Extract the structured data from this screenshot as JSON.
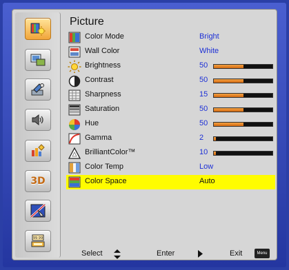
{
  "menu": {
    "title": "Picture",
    "items": [
      {
        "label": "Color Mode",
        "value": "Bright",
        "icon": "color-mode-icon"
      },
      {
        "label": "Wall Color",
        "value": "White",
        "icon": "wall-color-icon"
      },
      {
        "label": "Brightness",
        "value": "50",
        "slider": 0.5,
        "icon": "brightness-icon"
      },
      {
        "label": "Contrast",
        "value": "50",
        "slider": 0.5,
        "icon": "contrast-icon"
      },
      {
        "label": "Sharpness",
        "value": "15",
        "slider": 0.5,
        "icon": "sharpness-icon"
      },
      {
        "label": "Saturation",
        "value": "50",
        "slider": 0.5,
        "icon": "saturation-icon"
      },
      {
        "label": "Hue",
        "value": "50",
        "slider": 0.5,
        "icon": "hue-icon"
      },
      {
        "label": "Gamma",
        "value": "2",
        "slider": 0.03,
        "icon": "gamma-icon"
      },
      {
        "label": "BrilliantColor™",
        "value": "10",
        "slider": 0.03,
        "icon": "brilliantcolor-icon"
      },
      {
        "label": "Color Temp",
        "value": "Low",
        "icon": "color-temp-icon"
      },
      {
        "label": "Color Space",
        "value": "Auto",
        "icon": "color-space-icon",
        "selected": true
      }
    ]
  },
  "sidebar": [
    {
      "name": "picture-icon",
      "active": true
    },
    {
      "name": "display-icon"
    },
    {
      "name": "setup-icon"
    },
    {
      "name": "volume-icon"
    },
    {
      "name": "options-icon"
    },
    {
      "name": "3d-icon",
      "label": "3D"
    },
    {
      "name": "language-icon"
    },
    {
      "name": "network-icon"
    }
  ],
  "footer": {
    "select": "Select",
    "enter": "Enter",
    "exit": "Exit",
    "menu_key": "Menu"
  },
  "colors": {
    "selection": "#fffc00",
    "value_text": "#1c2fd6",
    "slider_fill": "#e98a2b",
    "frame": "#2b3fa6"
  }
}
